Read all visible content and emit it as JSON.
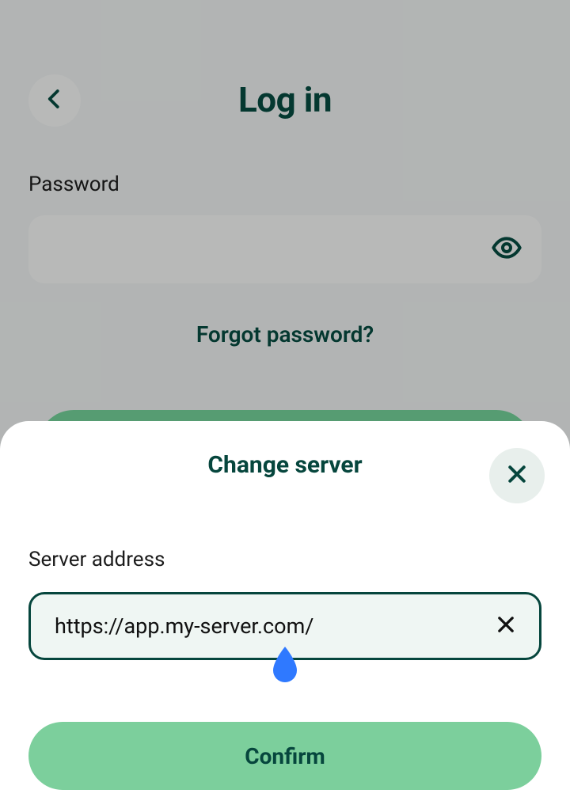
{
  "login": {
    "title": "Log in",
    "password_label": "Password",
    "forgot_label": "Forgot password?"
  },
  "sheet": {
    "title": "Change server",
    "server_label": "Server address",
    "server_value": "https://app.my-server.com/",
    "confirm_label": "Confirm"
  },
  "colors": {
    "accent_dark": "#06463d",
    "accent_green": "#7ccf9c",
    "cursor_handle": "#2f79ff"
  }
}
